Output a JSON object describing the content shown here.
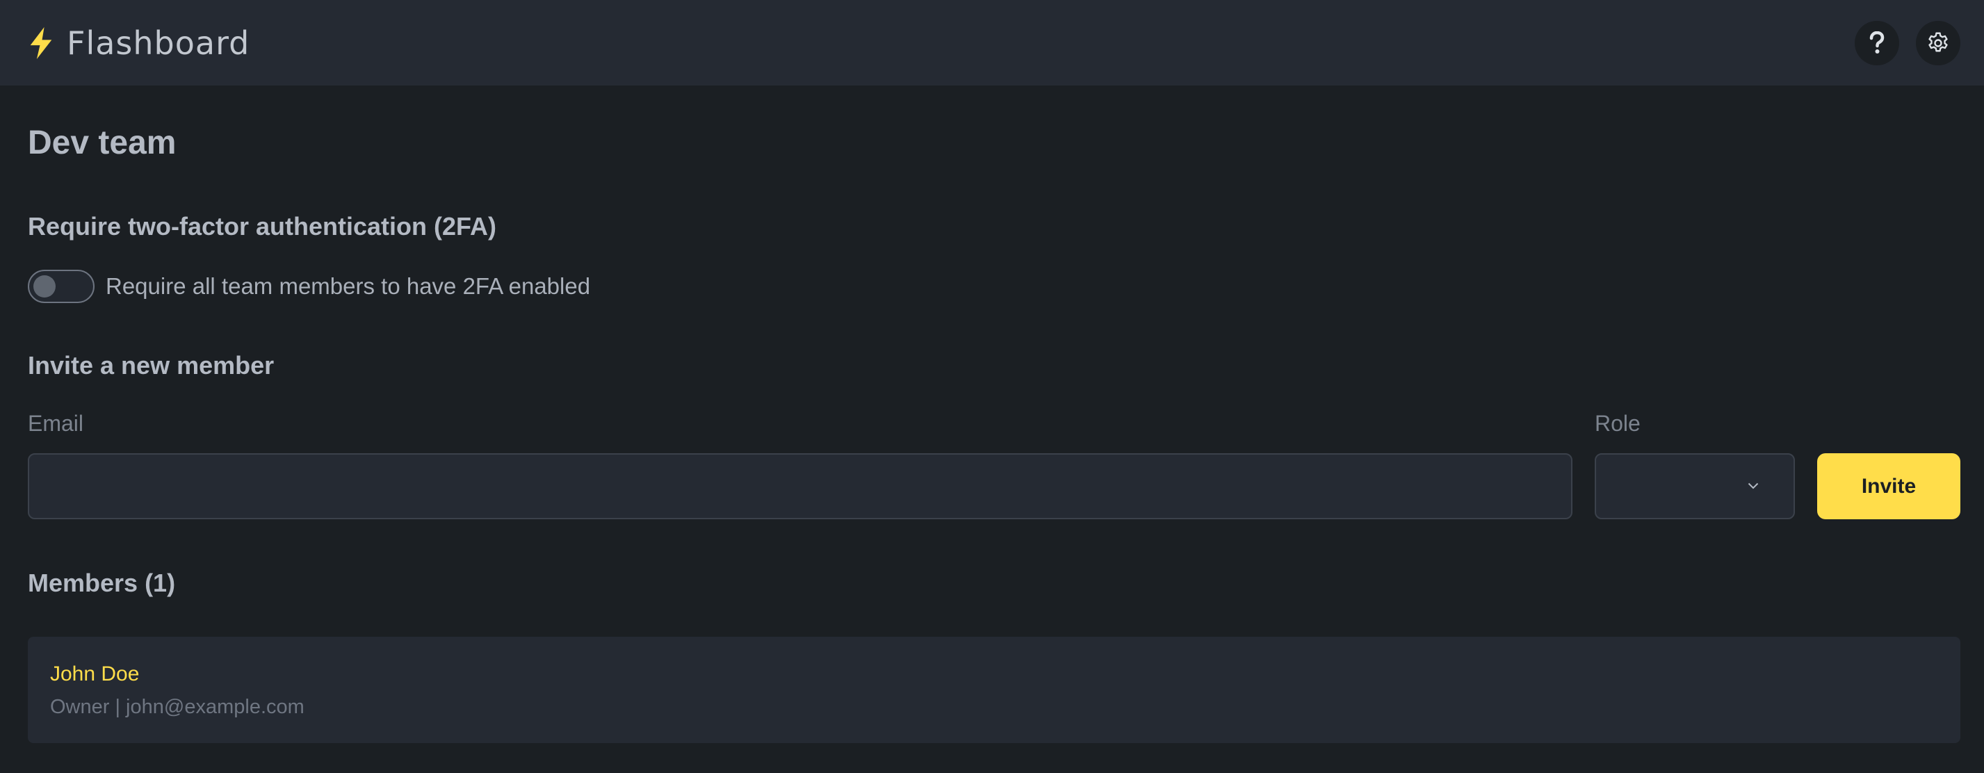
{
  "app": {
    "name": "Flashboard",
    "accent_color": "#ffdd4a",
    "logo_icon": "lightning-bolt-icon"
  },
  "header": {
    "help_icon": "question-mark-icon",
    "settings_icon": "gear-icon"
  },
  "page": {
    "title": "Dev team"
  },
  "two_factor": {
    "title": "Require two-factor authentication (2FA)",
    "toggle_label": "Require all team members to have 2FA enabled",
    "enabled": false
  },
  "invite": {
    "title": "Invite a new member",
    "email_label": "Email",
    "email_value": "",
    "role_label": "Role",
    "role_value": "",
    "button_label": "Invite"
  },
  "members": {
    "title": "Members (1)",
    "items": [
      {
        "name": "John Doe",
        "meta": "Owner | john@example.com"
      }
    ]
  }
}
